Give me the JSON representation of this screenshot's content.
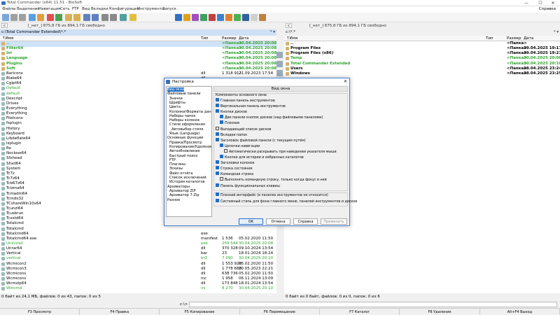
{
  "window": {
    "title": "Total Commander (x64) 11.51 - BioSoft",
    "controls": [
      "—",
      "☐",
      "✕"
    ]
  },
  "menu": [
    "Файлы",
    "Выделение",
    "Навигация",
    "Сеть",
    "FTP",
    "Вид",
    "Вкладки",
    "Конфигурация",
    "Инструменты",
    "Запуск"
  ],
  "menu_help": "Справка",
  "left": {
    "drive": "c",
    "drive_info": "[_нет_]  875,8 ГБ из 894,1 ГБ свободно",
    "path": "c:\\Total Commander Extended\\*.*",
    "columns": {
      "name": "↑Имя",
      "type": "Тип",
      "size": "Размер",
      "date": "Дата"
    },
    "rows": [
      {
        "n": "..",
        "t": "",
        "s": "<Папка>",
        "d": "30.04.2025 20:08",
        "g": true,
        "dir": true
      },
      {
        "n": "Filter64",
        "t": "",
        "s": "<Папка>",
        "d": "30.04.2025 20:08",
        "g": true,
        "dir": true
      },
      {
        "n": "Ini",
        "t": "",
        "s": "<Папка>",
        "d": "30.04.2025 20:08",
        "g": true,
        "dir": true
      },
      {
        "n": "Language",
        "t": "",
        "s": "<Папка>",
        "d": "30.04.2025 20:08",
        "g": true,
        "dir": true
      },
      {
        "n": "Plugins",
        "t": "",
        "s": "<Папка>",
        "d": "30.04.2025 20:08",
        "g": true,
        "dir": true
      },
      {
        "n": "Soft",
        "t": "",
        "s": "<Папка>",
        "d": "30.04.2025 20:08",
        "g": true,
        "dir": true
      },
      {
        "n": "Baricons",
        "t": "dll",
        "s": "1 318 912",
        "d": "21.09.2023 17:54"
      },
      {
        "n": "Blake64",
        "t": "dll",
        "s": "",
        "d": ""
      },
      {
        "n": "Cglpt64",
        "t": "",
        "s": "",
        "d": ""
      },
      {
        "n": "Default",
        "t": "",
        "s": "",
        "d": "",
        "g": true
      },
      {
        "n": "default",
        "t": "",
        "s": "",
        "d": "",
        "g": true
      },
      {
        "n": "Descript",
        "t": "",
        "s": "",
        "d": ""
      },
      {
        "n": "Drives",
        "t": "",
        "s": "",
        "d": ""
      },
      {
        "n": "Everything",
        "t": "",
        "s": "",
        "d": ""
      },
      {
        "n": "Everything",
        "t": "",
        "s": "",
        "d": ""
      },
      {
        "n": "FileIcons",
        "t": "",
        "s": "",
        "d": ""
      },
      {
        "n": "fsplugin",
        "t": "",
        "s": "",
        "d": ""
      },
      {
        "n": "History",
        "t": "",
        "s": "",
        "d": ""
      },
      {
        "n": "Keyboard",
        "t": "",
        "s": "",
        "d": ""
      },
      {
        "n": "Libdeflate64",
        "t": "",
        "s": "",
        "d": ""
      },
      {
        "n": "lsplugin",
        "t": "",
        "s": "",
        "d": ""
      },
      {
        "n": "Ro",
        "t": "",
        "s": "",
        "d": ""
      },
      {
        "n": "Noclose64",
        "t": "",
        "s": "",
        "d": ""
      },
      {
        "n": "Sfxhead",
        "t": "",
        "s": "",
        "d": ""
      },
      {
        "n": "Shxd64",
        "t": "",
        "s": "",
        "d": ""
      },
      {
        "n": "System",
        "t": "",
        "s": "",
        "d": ""
      },
      {
        "n": "Tc7z",
        "t": "",
        "s": "",
        "d": ""
      },
      {
        "n": "Tc7z64",
        "t": "",
        "s": "",
        "d": ""
      },
      {
        "n": "Tcb67z64",
        "t": "",
        "s": "",
        "d": ""
      },
      {
        "n": "Tclzma64",
        "t": "",
        "s": "",
        "d": ""
      },
      {
        "n": "Tcmadm64",
        "t": "",
        "s": "",
        "d": ""
      },
      {
        "n": "Tcmdx32",
        "t": "",
        "s": "",
        "d": ""
      },
      {
        "n": "TCshareWin10x64",
        "t": "",
        "s": "",
        "d": ""
      },
      {
        "n": "Tcunzl64",
        "t": "",
        "s": "",
        "d": ""
      },
      {
        "n": "Tcusbrun",
        "t": "",
        "s": "",
        "d": ""
      },
      {
        "n": "Tcxstd64",
        "t": "",
        "s": "",
        "d": ""
      },
      {
        "n": "Totalcmd",
        "t": "",
        "s": "",
        "d": ""
      },
      {
        "n": "Totalcmd",
        "t": "",
        "s": "",
        "d": ""
      },
      {
        "n": "Totalcmd64",
        "t": "exe",
        "s": "",
        "d": ""
      },
      {
        "n": "Totalcmd64.exe",
        "t": "manifest",
        "s": "1 536",
        "d": "05.02.2020 11:50"
      },
      {
        "n": "Uninstall",
        "t": "exe",
        "s": "259 544",
        "d": "30.04.2025 20:08",
        "g": true
      },
      {
        "n": "Unrar64",
        "t": "dll",
        "s": "370 328",
        "d": "09.10.2024 13:54"
      },
      {
        "n": "Vertical",
        "t": "bar",
        "s": "23",
        "d": "18.01.2024 18:24"
      },
      {
        "n": "vertical",
        "t": "br2",
        "s": "7 090",
        "d": "30.04.2025 20:10",
        "g": true
      },
      {
        "n": "Wcmicon2",
        "t": "dll",
        "s": "1 553 920",
        "d": "05.02.2020 11:50"
      },
      {
        "n": "Wcmicon3",
        "t": "dll",
        "s": "1 778 688",
        "d": "20.05.2023 22:21"
      },
      {
        "n": "Wcmicons",
        "t": "dll",
        "s": "638 736",
        "d": "05.02.2020 11:50"
      },
      {
        "n": "Wcmicons",
        "t": "inc",
        "s": "1 958",
        "d": "06.11.2024 13:09"
      },
      {
        "n": "Wcmzip64",
        "t": "dll",
        "s": "173 848",
        "d": "18.01.2024 13:54"
      },
      {
        "n": "Wincmd",
        "t": "ini",
        "s": "8 270",
        "d": "30.04.2025 20:10",
        "g": true
      }
    ],
    "status": "0 байт из 24,1 МБ, файлов: 0 из 43, папок: 0 из 5"
  },
  "right": {
    "drive": "c",
    "drive_info": "[_нет_]  875,8 ГБ из 894,1 ГБ свободно",
    "path": "c:\\*.*",
    "columns": {
      "name": "↑Имя",
      "type": "Тип",
      "size": "Размер",
      "date": "Дата"
    },
    "rows": [
      {
        "n": "..",
        "t": "",
        "s": "<Папка>",
        "d": "",
        "g": false,
        "dir": true
      },
      {
        "n": "Program Files",
        "t": "",
        "s": "<Папка>",
        "d": "29.04.2025 19:17",
        "dir": true
      },
      {
        "n": "Program Files (x86)",
        "t": "",
        "s": "<Папка>",
        "d": "29.04.2025 19:23",
        "dir": true
      },
      {
        "n": "Temp",
        "t": "",
        "s": "<Папка>",
        "d": "30.04.2025 20:08",
        "g": true,
        "dir": true
      },
      {
        "n": "Total Commander Extended",
        "t": "",
        "s": "<Папка>",
        "d": "30.04.2025 20:10",
        "g": true,
        "dir": true
      },
      {
        "n": "Users",
        "t": "",
        "s": "<Папка>",
        "d": "28.04.2025 23:24",
        "dir": true
      },
      {
        "n": "Windows",
        "t": "",
        "s": "<Папка>",
        "d": "28.04.2025 23:25",
        "dir": true
      }
    ],
    "status": "0 байт из 0 байт, файлов: 0 из 0, папок: 0 из 6"
  },
  "cmdline": "c:\\>",
  "fkeys": [
    "F3 Просмотр",
    "F4 Правка",
    "F5 Копирование",
    "F6 Перемещение",
    "F7 Каталог",
    "F8 Удаление",
    "Alt+F4 Выход"
  ],
  "dialog": {
    "title": "Настройка",
    "section_title": "Вид окна",
    "tree": [
      "Вид окна",
      "Файловые панели",
      "Значки",
      "Шрифты",
      "Цвета",
      "Колонки/Форматы данных",
      "Наборы папок",
      "Наборы колонок",
      "Стили оформления",
      "Автовыбор стиля",
      "Язык (Language)",
      "Основные функции",
      "Правка/Просмотр",
      "Копирование/Удаление",
      "Автообновление",
      "Быстрый поиск",
      "FTP",
      "Плагины",
      "Эскизы",
      "Файл отчёта",
      "Список исключений",
      "История каталогов",
      "Архиваторы",
      "Архиватор ZIP",
      "Архиватор 7-Zip",
      "Разное"
    ],
    "group_main": "Компоненты основного окна",
    "options": [
      {
        "label": "Главная панель инструментов",
        "on": true,
        "lvl": 0
      },
      {
        "label": "Вертикальная панель инструментов",
        "on": true,
        "lvl": 0
      },
      {
        "label": "Кнопки дисков",
        "on": true,
        "lvl": 0
      },
      {
        "label": "Две панели кнопок дисков (над файловыми панелями)",
        "on": true,
        "lvl": 1
      },
      {
        "label": "Плоские",
        "on": true,
        "lvl": 1
      },
      {
        "label": "Выпадающий список дисков",
        "on": false,
        "lvl": 0
      },
      {
        "label": "Вкладки папок",
        "on": true,
        "lvl": 0
      },
      {
        "label": "Заголовок файловой панели (с текущим путём)",
        "on": true,
        "lvl": 0
      },
      {
        "label": "Цепочки навигации",
        "on": true,
        "lvl": 1
      },
      {
        "label": "Автоматически раскрывать при наведении указателя мыши",
        "on": false,
        "lvl": 2
      },
      {
        "label": "Кнопки для истории и избранных каталогов",
        "on": true,
        "lvl": 1
      },
      {
        "label": "Заголовки колонок",
        "on": true,
        "lvl": 0
      },
      {
        "label": "Строка состояния",
        "on": true,
        "lvl": 0
      },
      {
        "label": "Командная строка",
        "on": true,
        "lvl": 0
      },
      {
        "label": "Выполнять командную строку, только когда фокус в ней",
        "on": false,
        "lvl": 1
      },
      {
        "label": "Панель функциональных клавиш",
        "on": true,
        "lvl": 0
      }
    ],
    "options2": [
      {
        "label": "Плоский интерфейс (в панелях инструментов не относится)",
        "on": true
      },
      {
        "label": "Системный стиль для фона главного меню, панелей инструментов и дисков",
        "on": true
      }
    ],
    "buttons": {
      "ok": "ОК",
      "cancel": "Отмена",
      "help": "Справка",
      "apply": "Применить"
    }
  }
}
